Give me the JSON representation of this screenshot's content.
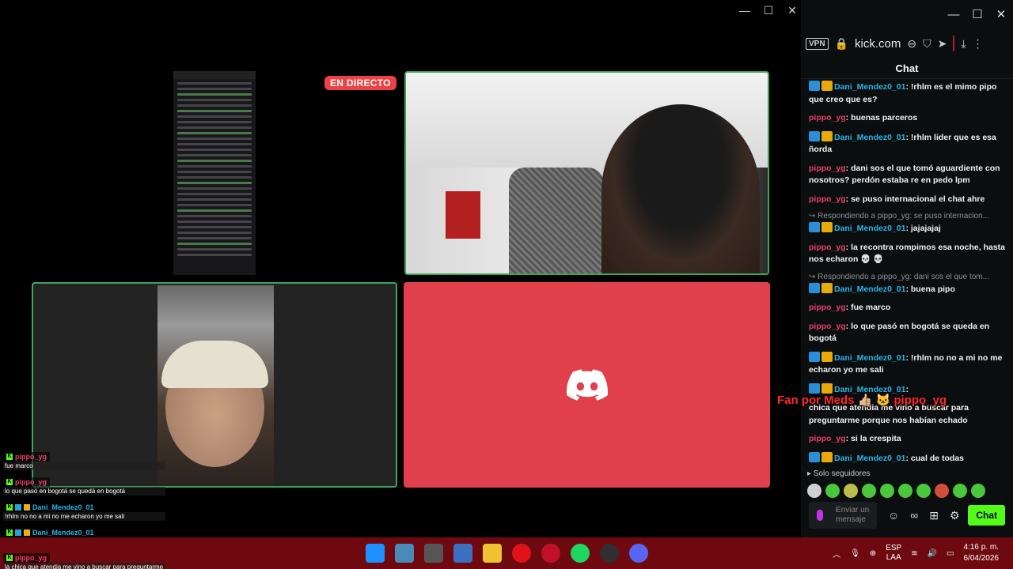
{
  "discord": {
    "window_controls": [
      "—",
      "☐",
      "✕"
    ],
    "live_badge": "EN DIRECTO"
  },
  "overlay_chat": [
    {
      "user": "pippo_yg",
      "text": "fue marco"
    },
    {
      "user": "pippo_yg",
      "text": "lo que pasó en bogotá se quedá en bogotá"
    },
    {
      "user": "Dani_Mendez0_01",
      "text": "!rhlm no no a mi no me echaron yo me sali"
    },
    {
      "user": "Dani_Mendez0_01",
      "text": ""
    },
    {
      "user": "pippo_yg",
      "text": "la chica que atendia me vino a buscar para preguntarme"
    }
  ],
  "browser": {
    "window_controls": [
      "—",
      "☐",
      "✕"
    ],
    "vpn": "VPN",
    "url": "kick.com",
    "chat_title": "Chat",
    "messages": [
      {
        "type": "msg",
        "user": "Dani_Mendez0_01",
        "cls": "d",
        "badges": true,
        "text": "!rhlm es el mimo pipo que creo que es?"
      },
      {
        "type": "msg",
        "user": "pippo_yg",
        "cls": "p",
        "badges": false,
        "text": "buenas parceros"
      },
      {
        "type": "msg",
        "user": "Dani_Mendez0_01",
        "cls": "d",
        "badges": true,
        "text": "!rhlm lider que es esa ñorda"
      },
      {
        "type": "msg",
        "user": "pippo_yg",
        "cls": "p",
        "badges": false,
        "text": "dani sos el que tomó aguardiente con nosotros? perdón estaba re en pedo lpm"
      },
      {
        "type": "msg",
        "user": "pippo_yg",
        "cls": "p",
        "badges": false,
        "text": "se puso internacional el chat ahre"
      },
      {
        "type": "reply",
        "text": "↪ Respondiendo a pippo_yg: se puso internacion..."
      },
      {
        "type": "msg",
        "user": "Dani_Mendez0_01",
        "cls": "d",
        "badges": true,
        "text": "jajajajaj"
      },
      {
        "type": "msg",
        "user": "pippo_yg",
        "cls": "p",
        "badges": false,
        "text": "la recontra rompimos esa noche, hasta nos echaron 💀 💀"
      },
      {
        "type": "reply",
        "text": "↪ Respondiendo a pippo_yg: dani sos el que tom..."
      },
      {
        "type": "msg",
        "user": "Dani_Mendez0_01",
        "cls": "d",
        "badges": true,
        "text": "buena pipo"
      },
      {
        "type": "msg",
        "user": "pippo_yg",
        "cls": "p",
        "badges": false,
        "text": "fue marco"
      },
      {
        "type": "msg",
        "user": "pippo_yg",
        "cls": "p",
        "badges": false,
        "text": "lo que pasó en bogotá se queda en bogotá"
      },
      {
        "type": "msg",
        "user": "Dani_Mendez0_01",
        "cls": "d",
        "badges": true,
        "text": "!rhlm no no a mi no me echaron yo me sali"
      },
      {
        "type": "msg",
        "user": "Dani_Mendez0_01",
        "cls": "d",
        "badges": true,
        "text": ""
      },
      {
        "type": "msg",
        "user": "",
        "cls": "p",
        "badges": false,
        "text": "chica que atendia me vino a buscar para preguntarme porque nos habían echado"
      },
      {
        "type": "msg",
        "user": "pippo_yg",
        "cls": "p",
        "badges": false,
        "text": "si la crespita"
      },
      {
        "type": "msg",
        "user": "Dani_Mendez0_01",
        "cls": "d",
        "badges": true,
        "text": "cual de todas"
      }
    ],
    "followers_only": "Solo seguidores",
    "input_placeholder": "Enviar un mensaje",
    "chat_button": "Chat"
  },
  "fan_overlay": "Fan por Meds 👍🏼 🐱 pippo_yg",
  "taskbar": {
    "lang_top": "ESP",
    "lang_bottom": "LAA",
    "time": "4:16 p. m.",
    "date": "6/04/2026"
  }
}
